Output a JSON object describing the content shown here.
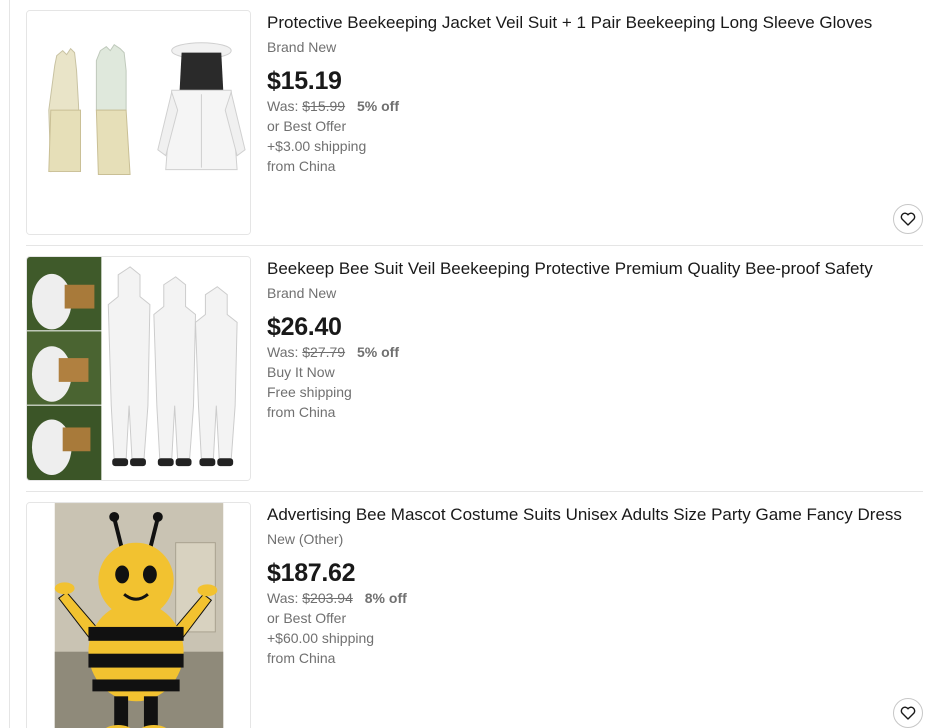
{
  "listings": [
    {
      "title": "Protective Beekeeping Jacket Veil Suit + 1 Pair Beekeeping Long Sleeve Gloves",
      "condition": "Brand New",
      "price": "$15.19",
      "was_label": "Was:",
      "was_price": "$15.99",
      "discount": "5% off",
      "purchase_option": "or Best Offer",
      "shipping": "+$3.00 shipping",
      "location": "from China",
      "watch_icon": "heart-icon"
    },
    {
      "title": "Beekeep Bee Suit Veil Beekeeping Protective Premium Quality Bee-proof Safety",
      "condition": "Brand New",
      "price": "$26.40",
      "was_label": "Was:",
      "was_price": "$27.79",
      "discount": "5% off",
      "purchase_option": "Buy It Now",
      "shipping": "Free shipping",
      "location": "from China"
    },
    {
      "title": "Advertising Bee Mascot Costume Suits Unisex Adults Size Party Game Fancy Dress",
      "condition": "New (Other)",
      "price": "$187.62",
      "was_label": "Was:",
      "was_price": "$203.94",
      "discount": "8% off",
      "purchase_option": "or Best Offer",
      "shipping": "+$60.00 shipping",
      "location": "from China",
      "watch_icon": "heart-icon"
    }
  ],
  "colors": {
    "text": "#191919",
    "muted": "#707070",
    "border": "#e5e5e5"
  }
}
